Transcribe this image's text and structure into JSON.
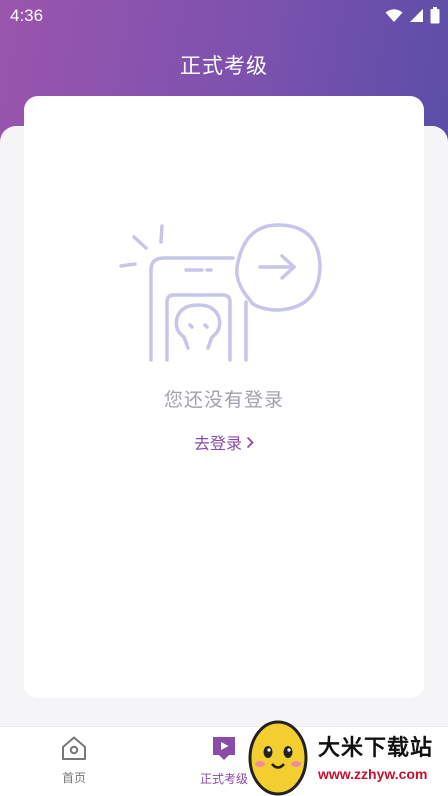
{
  "status_bar": {
    "time": "4:36",
    "icons": [
      "wifi-icon",
      "signal-icon",
      "battery-icon"
    ]
  },
  "header": {
    "title": "正式考级"
  },
  "empty_state": {
    "message": "您还没有登录",
    "login_link": "去登录",
    "illustration_icon": "phone-login-arrow-icon"
  },
  "tab_bar": {
    "tabs": [
      {
        "label": "首页",
        "icon": "home-icon",
        "active": false
      },
      {
        "label": "正式考级",
        "icon": "exam-bookmark-icon",
        "active": true
      }
    ]
  },
  "watermark": {
    "title": "大米下载站",
    "url": "www.zzhyw.com"
  },
  "colors": {
    "header_start": "#9a55ad",
    "header_end": "#5b4ea8",
    "accent": "#8a4ca8",
    "illustration": "#c7c6ea"
  }
}
